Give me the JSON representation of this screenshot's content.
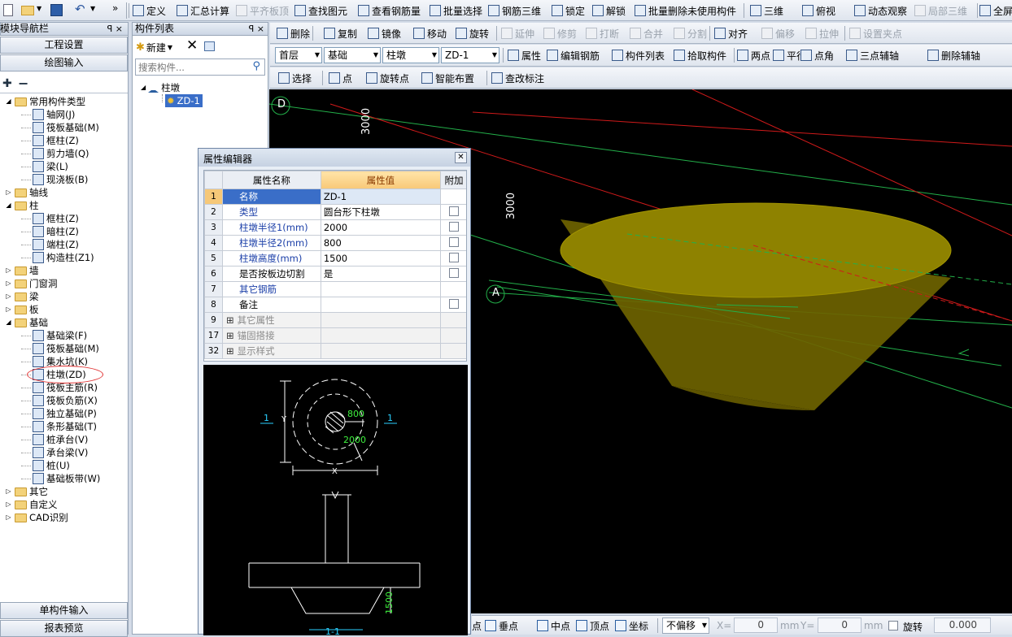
{
  "toolbar1": {
    "items": [
      "定义",
      "汇总计算",
      "平齐板顶",
      "查找图元",
      "查看钢筋量",
      "批量选择",
      "钢筋三维",
      "锁定",
      "解锁",
      "批量删除未使用构件",
      "三维",
      "俯视",
      "动态观察",
      "局部三维",
      "全屏"
    ]
  },
  "toolbar2": {
    "items": [
      "删除",
      "复制",
      "镜像",
      "移动",
      "旋转",
      "延伸",
      "修剪",
      "打断",
      "合并",
      "分割",
      "对齐",
      "偏移",
      "拉伸",
      "设置夹点"
    ]
  },
  "toolbar3": {
    "floor": "首层",
    "category": "基础",
    "type": "柱墩",
    "component": "ZD-1",
    "items": [
      "属性",
      "编辑钢筋",
      "构件列表",
      "拾取构件",
      "两点",
      "平行",
      "点角",
      "三点辅轴",
      "删除辅轴"
    ]
  },
  "toolbar4": {
    "items": [
      "选择",
      "点",
      "旋转点",
      "智能布置",
      "查改标注"
    ]
  },
  "nav": {
    "title": "模块导航栏",
    "pin": "ꟼ ×",
    "btn_project": "工程设置",
    "btn_draw": "绘图输入",
    "btn_single": "单构件输入",
    "btn_report": "报表预览",
    "tree": [
      {
        "level": 0,
        "label": "常用构件类型",
        "exp": "-",
        "kind": "folder"
      },
      {
        "level": 1,
        "label": "轴网(J)",
        "kind": "comp"
      },
      {
        "level": 1,
        "label": "筏板基础(M)",
        "kind": "comp"
      },
      {
        "level": 1,
        "label": "框柱(Z)",
        "kind": "comp"
      },
      {
        "level": 1,
        "label": "剪力墙(Q)",
        "kind": "comp"
      },
      {
        "level": 1,
        "label": "梁(L)",
        "kind": "comp"
      },
      {
        "level": 1,
        "label": "现浇板(B)",
        "kind": "comp"
      },
      {
        "level": 0,
        "label": "轴线",
        "exp": "+",
        "kind": "folder"
      },
      {
        "level": 0,
        "label": "柱",
        "exp": "-",
        "kind": "folder"
      },
      {
        "level": 1,
        "label": "框柱(Z)",
        "kind": "comp"
      },
      {
        "level": 1,
        "label": "暗柱(Z)",
        "kind": "comp"
      },
      {
        "level": 1,
        "label": "端柱(Z)",
        "kind": "comp"
      },
      {
        "level": 1,
        "label": "构造柱(Z1)",
        "kind": "comp"
      },
      {
        "level": 0,
        "label": "墙",
        "exp": "+",
        "kind": "folder"
      },
      {
        "level": 0,
        "label": "门窗洞",
        "exp": "+",
        "kind": "folder"
      },
      {
        "level": 0,
        "label": "梁",
        "exp": "+",
        "kind": "folder"
      },
      {
        "level": 0,
        "label": "板",
        "exp": "+",
        "kind": "folder"
      },
      {
        "level": 0,
        "label": "基础",
        "exp": "-",
        "kind": "folder"
      },
      {
        "level": 1,
        "label": "基础梁(F)",
        "kind": "comp"
      },
      {
        "level": 1,
        "label": "筏板基础(M)",
        "kind": "comp"
      },
      {
        "level": 1,
        "label": "集水坑(K)",
        "kind": "comp"
      },
      {
        "level": 1,
        "label": "柱墩(ZD)",
        "kind": "comp",
        "circled": true
      },
      {
        "level": 1,
        "label": "筏板主筋(R)",
        "kind": "comp"
      },
      {
        "level": 1,
        "label": "筏板负筋(X)",
        "kind": "comp"
      },
      {
        "level": 1,
        "label": "独立基础(P)",
        "kind": "comp"
      },
      {
        "level": 1,
        "label": "条形基础(T)",
        "kind": "comp"
      },
      {
        "level": 1,
        "label": "桩承台(V)",
        "kind": "comp"
      },
      {
        "level": 1,
        "label": "承台梁(V)",
        "kind": "comp"
      },
      {
        "level": 1,
        "label": "桩(U)",
        "kind": "comp"
      },
      {
        "level": 1,
        "label": "基础板带(W)",
        "kind": "comp"
      },
      {
        "level": 0,
        "label": "其它",
        "exp": "+",
        "kind": "folder"
      },
      {
        "level": 0,
        "label": "自定义",
        "exp": "+",
        "kind": "folder"
      },
      {
        "level": 0,
        "label": "CAD识别",
        "exp": "+",
        "kind": "folder"
      }
    ]
  },
  "complist": {
    "title": "构件列表",
    "pin": "ꟼ ×",
    "new_label": "新建",
    "search_placeholder": "搜索构件...",
    "root": "柱墩",
    "child": "ZD-1"
  },
  "prop_editor": {
    "title": "属性编辑器",
    "col_name": "属性名称",
    "col_value": "属性值",
    "col_extra": "附加",
    "rows": [
      {
        "no": "1",
        "name": "名称",
        "value": "ZD-1",
        "chk": false,
        "blue": true,
        "sel": true
      },
      {
        "no": "2",
        "name": "类型",
        "value": "圆台形下柱墩",
        "chk": true,
        "blue": true
      },
      {
        "no": "3",
        "name": "柱墩半径1(mm)",
        "value": "2000",
        "chk": true,
        "blue": true
      },
      {
        "no": "4",
        "name": "柱墩半径2(mm)",
        "value": "800",
        "chk": true,
        "blue": true
      },
      {
        "no": "5",
        "name": "柱墩高度(mm)",
        "value": "1500",
        "chk": true,
        "blue": true
      },
      {
        "no": "6",
        "name": "是否按板边切割",
        "value": "是",
        "chk": true,
        "blue": false
      },
      {
        "no": "7",
        "name": "其它钢筋",
        "value": "",
        "chk": false,
        "blue": true
      },
      {
        "no": "8",
        "name": "备注",
        "value": "",
        "chk": true,
        "blue": false
      },
      {
        "no": "9",
        "name": "其它属性",
        "value": "",
        "chk": false,
        "blue": false,
        "grey": true,
        "plus": true
      },
      {
        "no": "17",
        "name": "锚固搭接",
        "value": "",
        "chk": false,
        "blue": false,
        "grey": true,
        "plus": true
      },
      {
        "no": "32",
        "name": "显示样式",
        "value": "",
        "chk": false,
        "blue": false,
        "grey": true,
        "plus": true
      }
    ],
    "sketch": {
      "r2": "800",
      "r1": "2000",
      "sec": "1",
      "x": "X",
      "y": "Y",
      "h": "1500",
      "cut": "1-1"
    }
  },
  "viewport": {
    "axis_d": "D",
    "axis_a": "A",
    "dim1": "3000",
    "dim2": "3000"
  },
  "statusbar": {
    "items": [
      "点",
      "垂点",
      "中点",
      "顶点",
      "坐标"
    ],
    "offset": "不偏移",
    "x_label": "X=",
    "x_val": "0",
    "mm1": "mm",
    "y_label": "Y=",
    "y_val": "0",
    "mm2": "mm",
    "rotate": "旋转",
    "angle": "0.000"
  },
  "colors": {
    "cad_bg": "#000000",
    "frustum": "#6e6300",
    "axis_green": "#23b04a",
    "axis_red": "#d01a1a"
  }
}
